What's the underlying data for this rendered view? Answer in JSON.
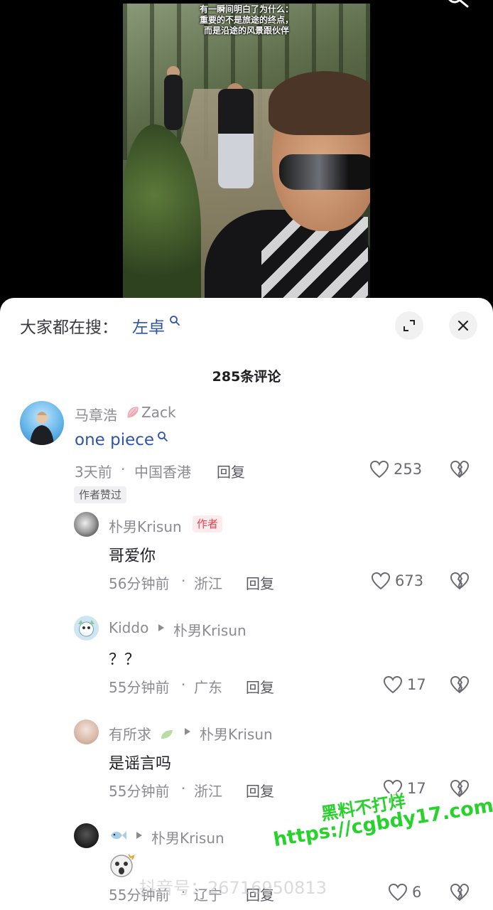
{
  "video": {
    "caption_lines": [
      "有一瞬间明白了为什么：",
      "重要的不是旅途的终点，",
      "而是沿途的风景跟伙伴"
    ]
  },
  "search": {
    "prefix": "大家都在搜：",
    "term": "左卓",
    "expand_icon": "expand-icon",
    "close_icon": "close-icon"
  },
  "comments_header": {
    "count_text": "285条评论"
  },
  "comments": [
    {
      "name": "马章浩",
      "name_suffix": "Zack",
      "text": "one piece",
      "time": "3天前",
      "location": "中国香港",
      "reply": "回复",
      "likes": "253",
      "badge": "作者赞过"
    }
  ],
  "replies": [
    {
      "name": "朴男Krisun",
      "badge": "作者",
      "text": "哥爱你",
      "time": "56分钟前",
      "location": "浙江",
      "reply": "回复",
      "likes": "673"
    },
    {
      "name": "Kiddo",
      "reply_to": "朴男Krisun",
      "text": "？？",
      "time": "55分钟前",
      "location": "广东",
      "reply": "回复",
      "likes": "17"
    },
    {
      "name": "有所求",
      "reply_to": "朴男Krisun",
      "text": "是谣言吗",
      "time": "55分钟前",
      "location": "浙江",
      "reply": "回复",
      "likes": "17"
    },
    {
      "name": "",
      "reply_to": "朴男Krisun",
      "text": "",
      "time": "55分钟前",
      "location": "辽宁",
      "reply": "回复",
      "likes": "6"
    }
  ],
  "meta_separator": "·",
  "watermarks": {
    "stamp_line1": "黑料不打烊",
    "stamp_line2": "https://cgbdy17.com",
    "douyin": "抖音号：26716950813"
  },
  "colors": {
    "link_blue": "#2f55a8",
    "author_badge_red": "#e8414f",
    "watermark_green": "#27d22b"
  }
}
